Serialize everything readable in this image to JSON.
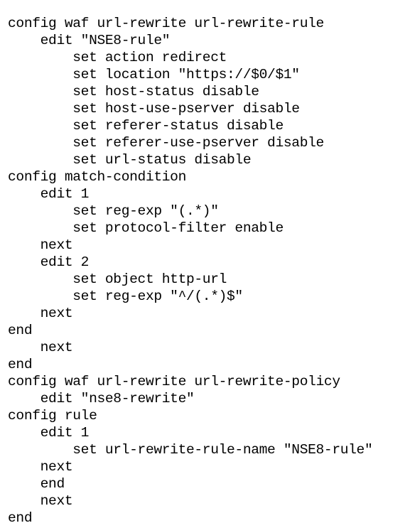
{
  "document": {
    "kind": "cli-configuration-listing",
    "text_color": "#000000",
    "background_color": "#ffffff",
    "line_count": 30,
    "lines": [
      "config waf url-rewrite url-rewrite-rule",
      "    edit \"NSE8-rule\"",
      "        set action redirect",
      "        set location \"https://$0/$1\"",
      "        set host-status disable",
      "        set host-use-pserver disable",
      "        set referer-status disable",
      "        set referer-use-pserver disable",
      "        set url-status disable",
      "config match-condition",
      "    edit 1",
      "        set reg-exp \"(.*)\"",
      "        set protocol-filter enable",
      "    next",
      "    edit 2",
      "        set object http-url",
      "        set reg-exp \"^/(.*)$\"",
      "    next",
      "end",
      "    next",
      "end",
      "config waf url-rewrite url-rewrite-policy",
      "    edit \"nse8-rewrite\"",
      "config rule",
      "    edit 1",
      "        set url-rewrite-rule-name \"NSE8-rule\"",
      "    next",
      "    end",
      "    next",
      "end"
    ]
  }
}
